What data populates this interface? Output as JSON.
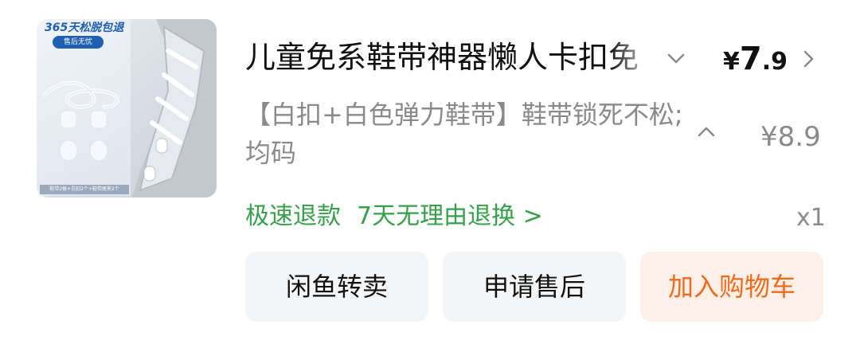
{
  "product": {
    "image_promo_title": "365天松脱包退",
    "image_promo_tag": "售后无忧",
    "image_promo_footer": "鞋带2根+白扣2个+鞋带尾夹2个",
    "title": "儿童免系鞋带神器懒人卡扣免",
    "price_symbol": "¥",
    "price_int": "7",
    "price_dec": ".9",
    "variant": "【白扣+白色弹力鞋带】鞋带锁死不松;均码",
    "original_price": "¥8.9",
    "refund_fast": "极速退款",
    "refund_policy": "7天无理由退换 >",
    "quantity": "x1"
  },
  "actions": {
    "resell": "闲鱼转卖",
    "after_sales": "申请售后",
    "add_to_cart": "加入购物车"
  },
  "colors": {
    "accent_orange": "#f26a1b",
    "refund_green": "#37a04a",
    "muted_text": "#8a8a8a",
    "button_bg": "#f3f5f7",
    "primary_button_bg": "#fdf0e8"
  }
}
